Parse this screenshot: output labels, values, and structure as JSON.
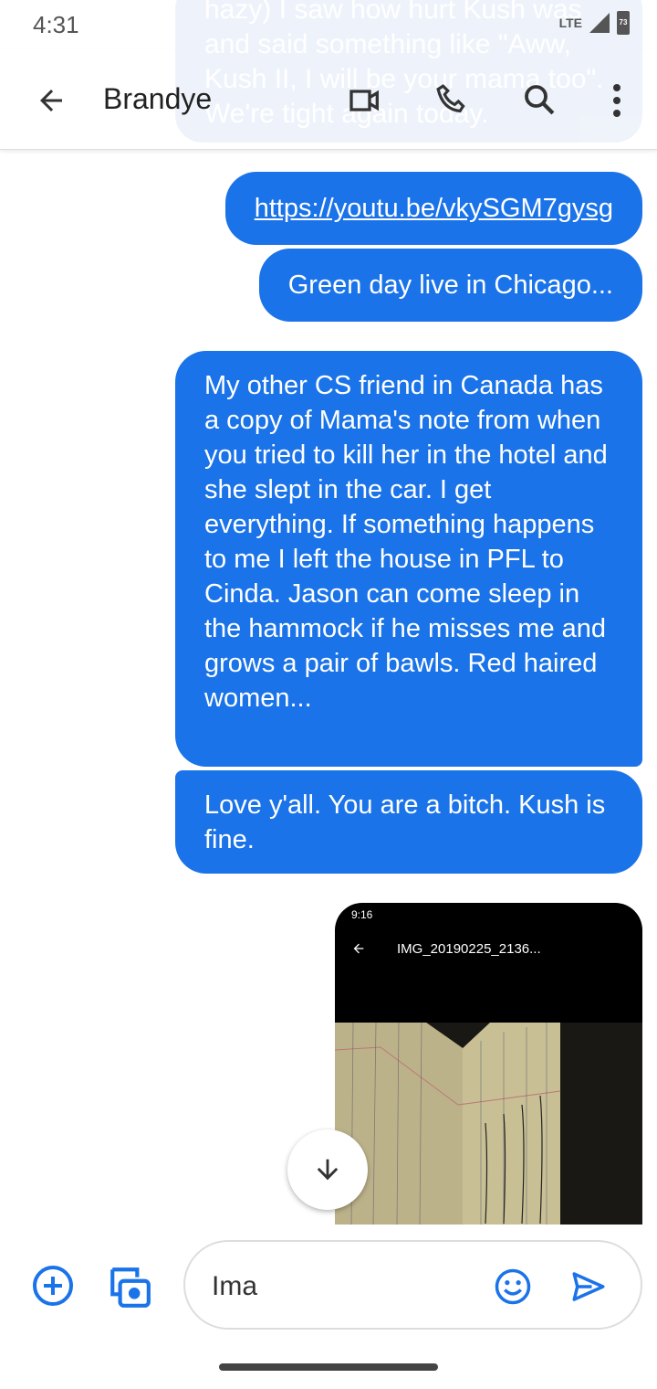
{
  "status": {
    "time": "4:31",
    "network": "LTE",
    "battery": "73"
  },
  "header": {
    "contact": "Brandye"
  },
  "ghost_message": "hazy) I saw how hurt Kush was and said something like \"Aww, Kush II, I will be your mama too\". We're tight again today.",
  "messages": [
    {
      "text": "https://youtu.be/vkySGM7gysg"
    },
    {
      "text": "Green day live in Chicago..."
    },
    {
      "text": "My other CS friend in Canada has a copy of Mama's note from when you tried to kill her in the hotel and she slept in the car. I get everything. If something happens to me I left the house in PFL to Cinda. Jason can come sleep in the hammock if he misses me and grows a pair of bawls. Red haired women..."
    },
    {
      "text": "Love y'all. You are a bitch. Kush is fine."
    }
  ],
  "image_message": {
    "time": "9:16",
    "title": "IMG_20190225_2136..."
  },
  "compose": {
    "value": "Ima"
  },
  "colors": {
    "accent": "#1a73e8"
  }
}
